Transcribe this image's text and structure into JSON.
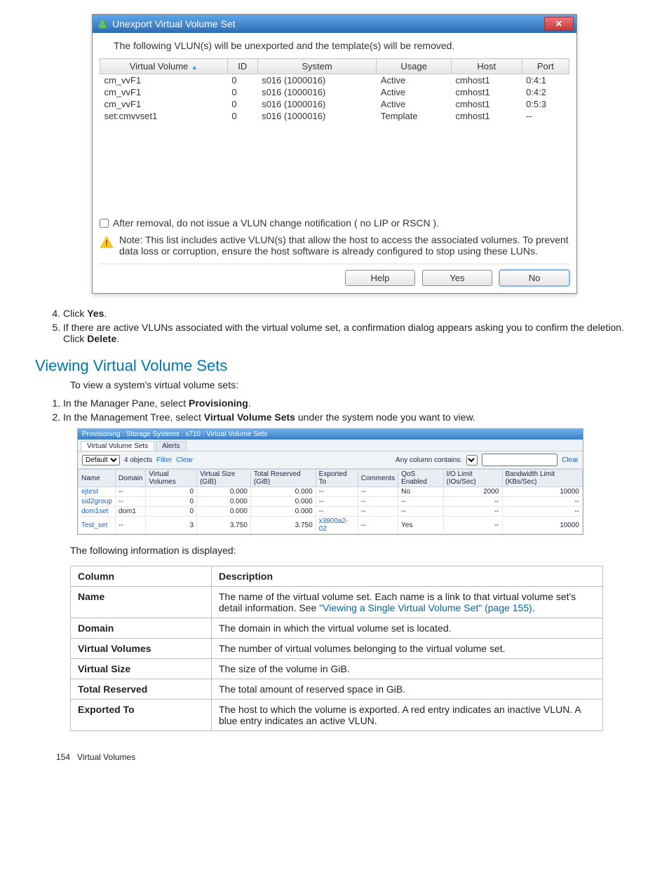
{
  "dialog": {
    "title": "Unexport Virtual Volume Set",
    "intro": "The following VLUN(s) will be unexported and the template(s) will be removed.",
    "columns": [
      "Virtual Volume",
      "ID",
      "System",
      "Usage",
      "Host",
      "Port"
    ],
    "rows": [
      {
        "vol": "cm_vvF1",
        "id": "0",
        "system": "s016 (1000016)",
        "usage": "Active",
        "host": "cmhost1",
        "port": "0:4:1"
      },
      {
        "vol": "cm_vvF1",
        "id": "0",
        "system": "s016 (1000016)",
        "usage": "Active",
        "host": "cmhost1",
        "port": "0:4:2"
      },
      {
        "vol": "cm_vvF1",
        "id": "0",
        "system": "s016 (1000016)",
        "usage": "Active",
        "host": "cmhost1",
        "port": "0:5:3"
      },
      {
        "vol": "set:cmvvset1",
        "id": "0",
        "system": "s016 (1000016)",
        "usage": "Template",
        "host": "cmhost1",
        "port": "--"
      }
    ],
    "checkbox_label": "After removal, do not issue a VLUN change notification ( no LIP or RSCN ).",
    "warning": "Note: This list includes active VLUN(s) that allow the host to access the associated volumes. To prevent data loss or corruption, ensure the host software is already configured to stop using these LUNs.",
    "buttons": {
      "help": "Help",
      "yes": "Yes",
      "no": "No"
    }
  },
  "steps1": {
    "start": 4,
    "items": [
      {
        "pre": "Click ",
        "bold": "Yes",
        "post": "."
      },
      {
        "pre": "If there are active VLUNs associated with the virtual volume set, a confirmation dialog appears asking you to confirm the deletion. Click ",
        "bold": "Delete",
        "post": "."
      }
    ]
  },
  "heading": "Viewing Virtual Volume Sets",
  "intro2": "To view a system's virtual volume sets:",
  "steps2": [
    {
      "pre": "In the Manager Pane, select ",
      "bold": "Provisioning",
      "post": "."
    },
    {
      "pre": "In the Management Tree, select ",
      "bold": "Virtual Volume Sets",
      "post": " under the system node you want to view."
    }
  ],
  "mini": {
    "breadcrumb": "Provisioning : Storage Systems : s710 : Virtual Volume Sets",
    "tabs": [
      "Virtual Volume Sets",
      "Alerts"
    ],
    "toolbar": {
      "default": "Default",
      "objects": "4 objects",
      "filter": "Filter",
      "clear": "Clear",
      "contains": "Any column contains:",
      "clear2": "Clear"
    },
    "columns": [
      "Name",
      "Domain",
      "Virtual Volumes",
      "Virtual Size (GiB)",
      "Total Reserved (GiB)",
      "Exported To",
      "Comments",
      "QoS Enabled",
      "I/O Limit (IOs/Sec)",
      "Bandwidth Limit (KBs/Sec)"
    ],
    "rows": [
      {
        "name": "ejtest",
        "domain": "--",
        "vv": "0",
        "vs": "0.000",
        "tr": "0.000",
        "et": "--",
        "com": "--",
        "qos": "No",
        "io": "2000",
        "bw": "10000"
      },
      {
        "name": "sid2group",
        "domain": "--",
        "vv": "0",
        "vs": "0.000",
        "tr": "0.000",
        "et": "--",
        "com": "--",
        "qos": "--",
        "io": "--",
        "bw": "--"
      },
      {
        "name": "dom1set",
        "domain": "dom1",
        "vv": "0",
        "vs": "0.000",
        "tr": "0.000",
        "et": "--",
        "com": "--",
        "qos": "--",
        "io": "--",
        "bw": "--"
      },
      {
        "name": "Test_set",
        "domain": "--",
        "vv": "3",
        "vs": "3.750",
        "tr": "3.750",
        "et": "x3800a2-02",
        "com": "--",
        "qos": "Yes",
        "io": "--",
        "bw": "10000"
      }
    ]
  },
  "displayed_intro": "The following information is displayed:",
  "desc": {
    "head": [
      "Column",
      "Description"
    ],
    "rows": [
      {
        "c": "Name",
        "d_pre": "The name of the virtual volume set. Each name is a link to that virtual volume set's detail information. See ",
        "d_link": "\"Viewing a Single Virtual Volume Set\" (page 155)",
        "d_post": "."
      },
      {
        "c": "Domain",
        "d": "The domain in which the virtual volume set is located."
      },
      {
        "c": "Virtual Volumes",
        "d": "The number of virtual volumes belonging to the virtual volume set."
      },
      {
        "c": "Virtual Size",
        "d": "The size of the volume in GiB."
      },
      {
        "c": "Total Reserved",
        "d": "The total amount of reserved space in GiB."
      },
      {
        "c": "Exported To",
        "d": "The host to which the volume is exported. A red entry indicates an inactive VLUN. A blue entry indicates an active VLUN."
      }
    ]
  },
  "footer": {
    "page": "154",
    "chapter": "Virtual Volumes"
  }
}
